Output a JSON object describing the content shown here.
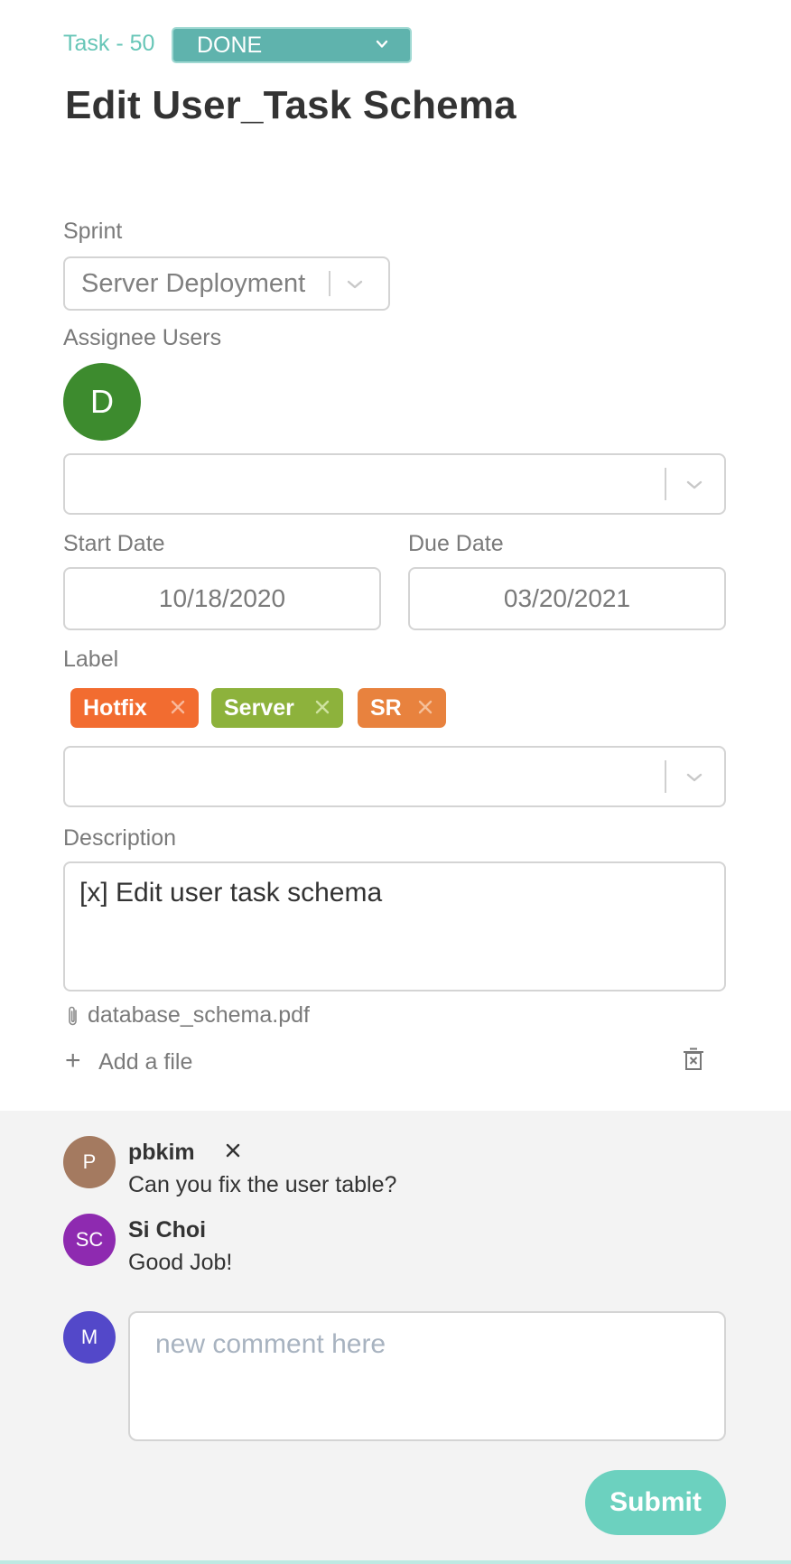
{
  "header": {
    "task_id": "Task - 50",
    "status": "DONE",
    "title": "Edit User_Task Schema"
  },
  "sprint": {
    "label": "Sprint",
    "value": "Server Deployment"
  },
  "assignees": {
    "label": "Assignee Users",
    "users": [
      {
        "initial": "D",
        "color": "#3d8b2e"
      }
    ],
    "select_value": ""
  },
  "dates": {
    "start_label": "Start Date",
    "start_value": "10/18/2020",
    "due_label": "Due Date",
    "due_value": "03/20/2021"
  },
  "labels": {
    "label": "Label",
    "tags": [
      {
        "text": "Hotfix",
        "color": "#f26c30"
      },
      {
        "text": "Server",
        "color": "#8db23c"
      },
      {
        "text": "SR",
        "color": "#e8823e"
      }
    ],
    "select_value": ""
  },
  "description": {
    "label": "Description",
    "value": "[x] Edit user task schema"
  },
  "attachments": {
    "files": [
      "database_schema.pdf"
    ],
    "add_label": "Add a file"
  },
  "comments": [
    {
      "initials": "P",
      "avatar_color": "#a47a60",
      "author": "pbkim",
      "text": "Can you fix the user table?"
    },
    {
      "initials": "SC",
      "avatar_color": "#8e2ab0",
      "author": "Si Choi",
      "text": "Good Job!"
    }
  ],
  "new_comment": {
    "avatar_initial": "M",
    "avatar_color": "#5348c9",
    "placeholder": "new comment here",
    "submit_label": "Submit"
  }
}
